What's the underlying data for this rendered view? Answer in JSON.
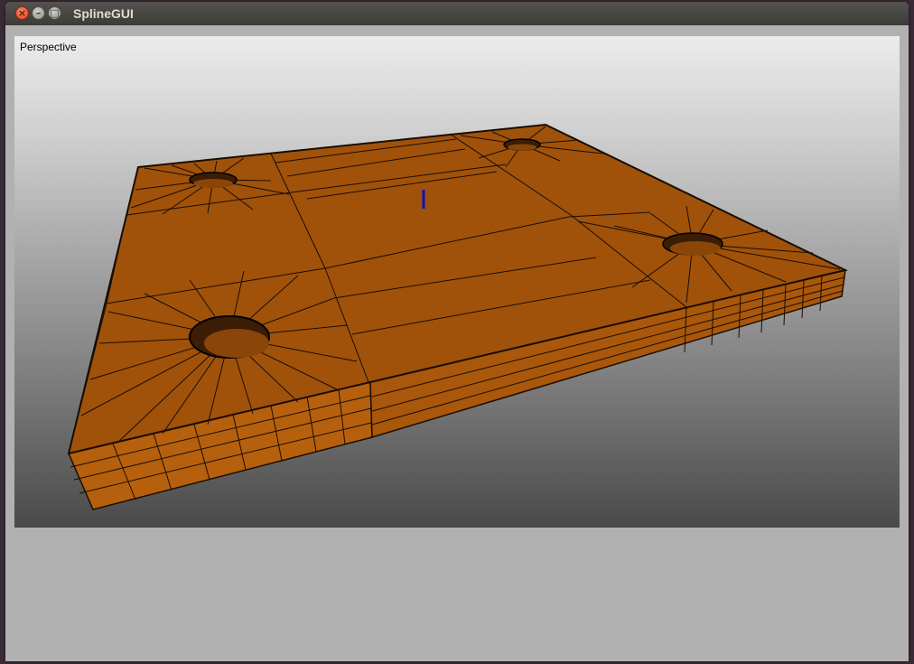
{
  "window": {
    "title": "SplineGUI"
  },
  "viewport": {
    "label": "Perspective"
  },
  "scene": {
    "object_color": "#a0520a",
    "side_color": "#b25f0c",
    "edge_color": "#1a0d00",
    "marker_color": "#1010c0"
  }
}
